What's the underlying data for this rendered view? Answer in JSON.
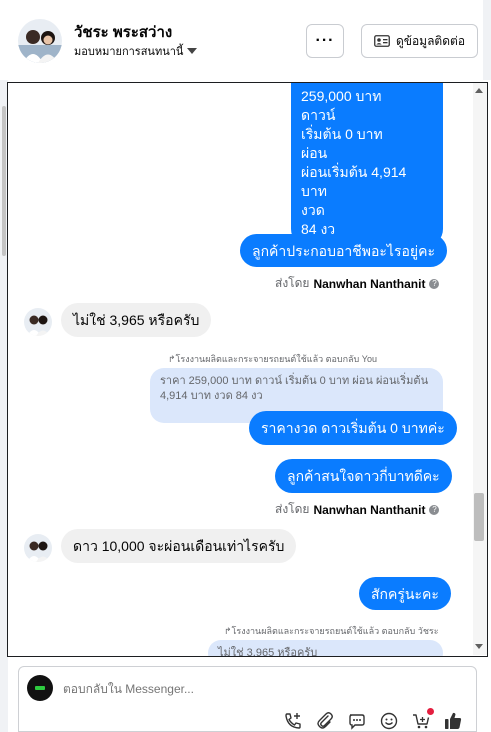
{
  "header": {
    "contact_name": "วัชระ พระสว่าง",
    "assign_label": "มอบหมายการสนทนานี้",
    "more_label": "···",
    "contact_info_label": "ดูข้อมูลติดต่อ"
  },
  "messages": {
    "top_block_lines": [
      "259,000 บาท",
      "ดาวน์",
      "เริ่มต้น 0 บาท",
      "ผ่อน",
      "ผ่อนเริ่มต้น 4,914 บาท",
      "งวด",
      "84 งว"
    ],
    "m1": "ลูกค้าประกอบอาชีพอะไรอยู่คะ",
    "sent_by_prefix": "ส่งโดย",
    "sent_by_name": "Nanwhan Nanthanit",
    "m2": "ไม่ใช่ 3,965 หรือครับ",
    "reply_note_1": "↱โรงงานผลิตและกระจายรถยนต์ใช้แล้ว ตอบกลับ You",
    "quote_1": "ราคา 259,000 บาท ดาวน์ เริ่มต้น 0 บาท ผ่อน ผ่อนเริ่มต้น 4,914 บาท งวด 84 งว",
    "m3": "ราคางวด ดาวเริ่มต้น 0 บาทค่ะ",
    "m4": "ลูกค้าสนใจดาวกี่บาทดีคะ",
    "m5": "ดาว 10,000 จะผ่อนเดือนเท่าไรครับ",
    "m6": "สักครู่นะคะ",
    "reply_note_2": "↱โรงงานผลิตและกระจายรถยนต์ใช้แล้ว ตอบกลับ วัชระ",
    "quote_2": "ไม่ใช่ 3,965 หรือครับ"
  },
  "composer": {
    "placeholder": "ตอบกลับใน Messenger..."
  },
  "icons": [
    "caret-down-icon",
    "contact-card-icon",
    "call-add-icon",
    "attach-icon",
    "reply-templates-icon",
    "emoji-icon",
    "cart-add-icon",
    "like-icon"
  ],
  "colors": {
    "outgoing": "#0a7cff",
    "incoming": "#f0f0f0",
    "quote": "#dbe7fb",
    "like": "#0a7cff",
    "notify": "#e41e3f"
  }
}
